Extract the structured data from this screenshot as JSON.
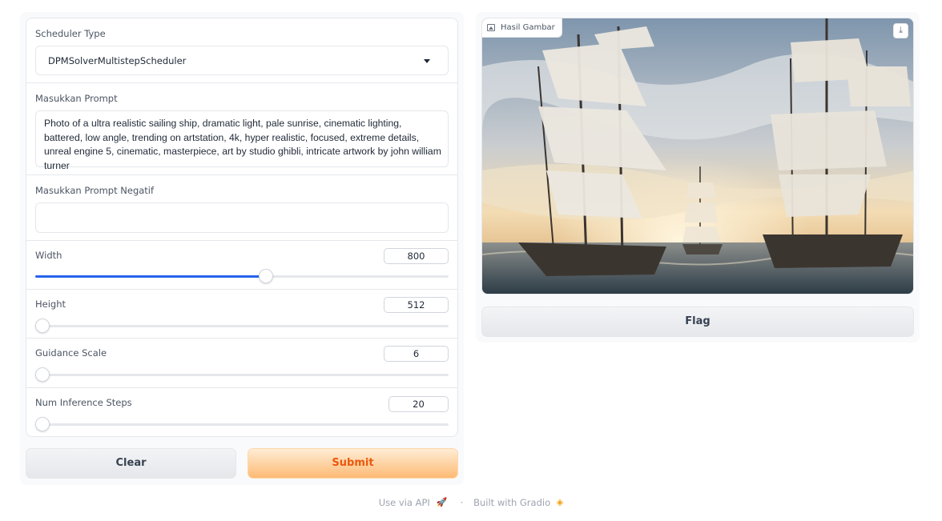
{
  "form": {
    "scheduler": {
      "label": "Scheduler Type",
      "value": "DPMSolverMultistepScheduler"
    },
    "prompt": {
      "label": "Masukkan Prompt",
      "value": "Photo of a ultra realistic sailing ship, dramatic light, pale sunrise, cinematic lighting, battered, low angle, trending on artstation, 4k, hyper realistic, focused, extreme details, unreal engine 5, cinematic, masterpiece, art by studio ghibli, intricate artwork by john william turner"
    },
    "negative_prompt": {
      "label": "Masukkan Prompt Negatif",
      "value": ""
    },
    "width": {
      "label": "Width",
      "value": "800",
      "fraction": 0.56
    },
    "height": {
      "label": "Height",
      "value": "512",
      "fraction": 0.0
    },
    "guidance": {
      "label": "Guidance Scale",
      "value": "6",
      "fraction": 0.0
    },
    "steps": {
      "label": "Num Inference Steps",
      "value": "20",
      "fraction": 0.0
    }
  },
  "buttons": {
    "clear": "Clear",
    "submit": "Submit",
    "flag": "Flag"
  },
  "output": {
    "label": "Hasil Gambar"
  },
  "footer": {
    "api": "Use via API",
    "separator": "·",
    "built": "Built with Gradio"
  },
  "colors": {
    "accent": "#2563eb",
    "submit_text": "#ea580c"
  }
}
